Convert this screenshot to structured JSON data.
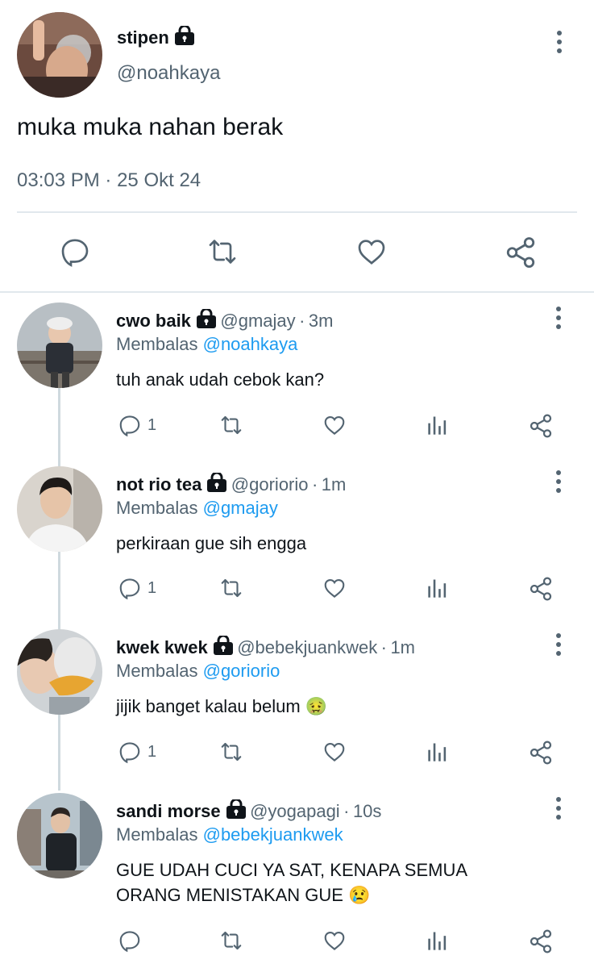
{
  "main_tweet": {
    "name": "stipen",
    "handle": "@noahkaya",
    "text": "muka muka nahan berak",
    "time": "03:03 PM",
    "sep": "·",
    "date": "25 Okt 24"
  },
  "replies": [
    {
      "name": "cwo baik",
      "handle": "@gmajay",
      "sep": "·",
      "time": "3m",
      "reply_label": "Membalas",
      "reply_to": "@noahkaya",
      "text": "tuh anak udah cebok kan?",
      "reply_count": "1"
    },
    {
      "name": "not rio tea",
      "handle": "@goriorio",
      "sep": "·",
      "time": "1m",
      "reply_label": "Membalas",
      "reply_to": "@gmajay",
      "text": "perkiraan gue sih engga",
      "reply_count": "1"
    },
    {
      "name": "kwek kwek",
      "handle": "@bebekjuankwek",
      "sep": "·",
      "time": "1m",
      "reply_label": "Membalas",
      "reply_to": "@goriorio",
      "text": "jijik banget kalau belum",
      "emoji": "🤢",
      "reply_count": "1"
    },
    {
      "name": "sandi morse",
      "handle": "@yogapagi",
      "sep": "·",
      "time": "10s",
      "reply_label": "Membalas",
      "reply_to": "@bebekjuankwek",
      "text_line1": "GUE UDAH CUCI YA SAT, KENAPA SEMUA",
      "text_line2": "ORANG MENISTAKAN GUE",
      "emoji": "😢",
      "reply_count": ""
    }
  ],
  "colors": {
    "accent": "#1d9bf0",
    "muted": "#536471",
    "text": "#0f1419",
    "divider": "#e1e8ed"
  }
}
